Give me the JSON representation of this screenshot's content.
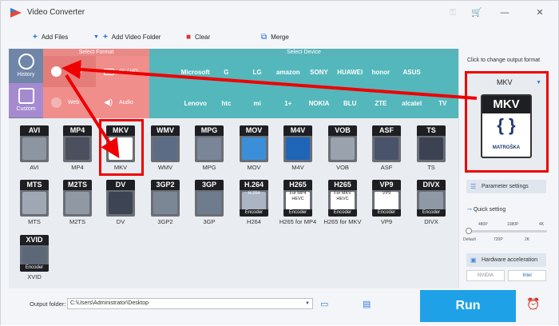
{
  "window": {
    "title": "Video Converter",
    "key_icon": "key-icon",
    "cart_icon": "cart-icon",
    "minimize": "—",
    "close": "✕"
  },
  "toolbar": {
    "add_files": "Add Files",
    "add_video_folder": "Add Video Folder",
    "clear": "Clear",
    "merge": "Merge"
  },
  "left_tabs": {
    "history": "History",
    "custom": "Custom"
  },
  "categories": {
    "select_format": "Select Format",
    "select_device": "Select Device",
    "format_tabs": [
      "Video",
      "4K / HD",
      "Web",
      "Audio"
    ]
  },
  "device_brands": [
    [
      "",
      "Microsoft",
      "G",
      "LG",
      "amazon",
      "SONY",
      "HUAWEI",
      "honor",
      "ASUS"
    ],
    [
      "",
      "Lenovo",
      "htc",
      "mi",
      "1+",
      "NOKIA",
      "BLU",
      "ZTE",
      "alcatel",
      "TV"
    ]
  ],
  "formats": [
    [
      {
        "tag": "AVI",
        "label": "AVI",
        "color": "#8d96a0"
      },
      {
        "tag": "MP4",
        "label": "MP4",
        "color": "#4b4f5e"
      },
      {
        "tag": "MKV",
        "label": "MKV",
        "color": "#ffffff"
      },
      {
        "tag": "WMV",
        "label": "WMV",
        "color": "#5d6c85"
      },
      {
        "tag": "MPG",
        "label": "MPG",
        "color": "#7a8597"
      },
      {
        "tag": "MOV",
        "label": "MOV",
        "color": "#3b8fd8"
      },
      {
        "tag": "M4V",
        "label": "M4V",
        "color": "#1f66b8"
      },
      {
        "tag": "VOB",
        "label": "VOB",
        "color": "#9aa3ad"
      },
      {
        "tag": "ASF",
        "label": "ASF",
        "color": "#49536a"
      },
      {
        "tag": "TS",
        "label": "TS",
        "color": "#3c4252"
      }
    ],
    [
      {
        "tag": "MTS",
        "label": "MTS",
        "color": "#9fa8b2"
      },
      {
        "tag": "M2TS",
        "label": "M2TS",
        "color": "#8f98a3"
      },
      {
        "tag": "DV",
        "label": "DV",
        "color": "#3d4453"
      },
      {
        "tag": "3GP2",
        "label": "3GP2",
        "color": "#7c8796"
      },
      {
        "tag": "3GP",
        "label": "3GP",
        "color": "#6f7c8d"
      },
      {
        "tag": "H.264",
        "label": "H264",
        "color": "#aab4c2",
        "sub": "H.264",
        "encoder": "Encoder"
      },
      {
        "tag": "H265",
        "label": "H265 for MP4",
        "color": "#ffffff",
        "sub": "For MP4\nHEVC",
        "encoder": "Encoder"
      },
      {
        "tag": "H265",
        "label": "H265 for MKV",
        "color": "#ffffff",
        "sub": "For MKV\nHEVC",
        "encoder": "Encoder"
      },
      {
        "tag": "VP9",
        "label": "VP9",
        "color": "#ffffff",
        "sub": "VP9",
        "encoder": "Encoder"
      },
      {
        "tag": "DIVX",
        "label": "DIVX",
        "color": "#8f99a6",
        "encoder": "Encoder"
      }
    ],
    [
      {
        "tag": "XVID",
        "label": "XVID",
        "color": "#5c6878",
        "encoder": "Encoder"
      }
    ]
  ],
  "right_panel": {
    "hint": "Click to change output format",
    "selected_format": "MKV",
    "preview_title": "MKV",
    "preview_brand": "MATROŠKA",
    "parameter_settings": "Parameter settings",
    "quick_setting": "Quick setting",
    "quality_top": [
      "480P",
      "1080P",
      "4K"
    ],
    "quality_bottom": [
      "Default",
      "720P",
      "2K"
    ],
    "hardware_acceleration": "Hardware acceleration",
    "gpu_nvidia": "NVIDIA",
    "gpu_intel": "Intel"
  },
  "bottom": {
    "output_folder_label": "Output folder:",
    "output_path": "C:\\Users\\Administrator\\Desktop",
    "run": "Run"
  },
  "colors": {
    "accent": "#1fa1e8",
    "format_red": "#ef8e8b",
    "device_teal": "#54b7bb",
    "annotation": "#e00000"
  }
}
